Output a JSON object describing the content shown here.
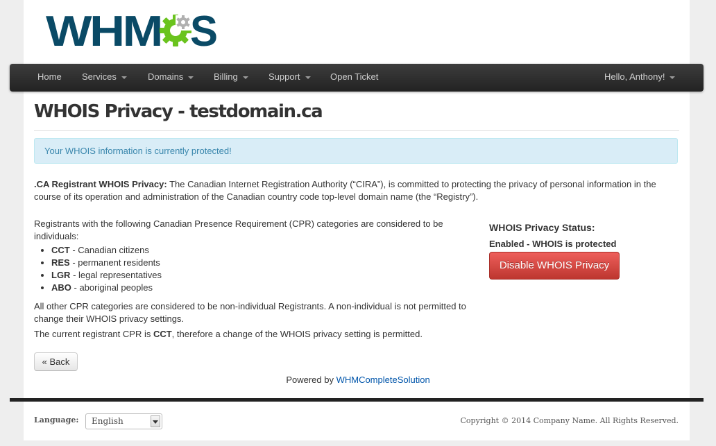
{
  "logo": {
    "text": "WHMCS",
    "icon": "gear-icon",
    "colors": {
      "text": "#0a4a66",
      "gear_green": "#6ac31e",
      "gear_gray": "#b0b0b0"
    }
  },
  "nav": {
    "items": [
      {
        "label": "Home",
        "has_caret": false
      },
      {
        "label": "Services",
        "has_caret": true
      },
      {
        "label": "Domains",
        "has_caret": true
      },
      {
        "label": "Billing",
        "has_caret": true
      },
      {
        "label": "Support",
        "has_caret": true
      },
      {
        "label": "Open Ticket",
        "has_caret": false
      }
    ],
    "user": "Hello, Anthony!"
  },
  "page": {
    "title": "WHOIS Privacy - testdomain.ca"
  },
  "alert": {
    "text": "Your WHOIS information is currently protected!",
    "color": "#3a87ad",
    "background": "#d9edf7"
  },
  "content": {
    "intro_bold": ".CA Registrant WHOIS Privacy:",
    "intro_text": " The Canadian Internet Registration Authority (“CIRA”), is committed to protecting the privacy of personal information in the course of its operation and administration of the Canadian country code top-level domain name (the “Registry”).",
    "cpr_intro": "Registrants with the following Canadian Presence Requirement (CPR) categories are considered to be individuals:",
    "cpr_list": [
      {
        "code": "CCT",
        "desc": " - Canadian citizens"
      },
      {
        "code": "RES",
        "desc": " - permanent residents"
      },
      {
        "code": "LGR",
        "desc": " - legal representatives"
      },
      {
        "code": "ABO",
        "desc": " - aboriginal peoples"
      }
    ],
    "non_individual": "All other CPR categories are considered to be non-individual Registrants. A non-individual is not permitted to change their WHOIS privacy settings.",
    "current_prefix": "The current registrant CPR is ",
    "current_code": "CCT",
    "current_suffix": ", therefore a change of the WHOIS privacy setting is permitted."
  },
  "status": {
    "heading": "WHOIS Privacy Status:",
    "value": "Enabled - WHOIS is protected",
    "button_label": "Disable WHOIS Privacy",
    "button_color": "#da4f49"
  },
  "back_button": "« Back",
  "powered": {
    "prefix": "Powered by ",
    "link": "WHMCompleteSolution"
  },
  "footer": {
    "language_label": "Language:",
    "language_value": "English",
    "copyright": "Copyright © 2014 Company Name. All Rights Reserved."
  }
}
